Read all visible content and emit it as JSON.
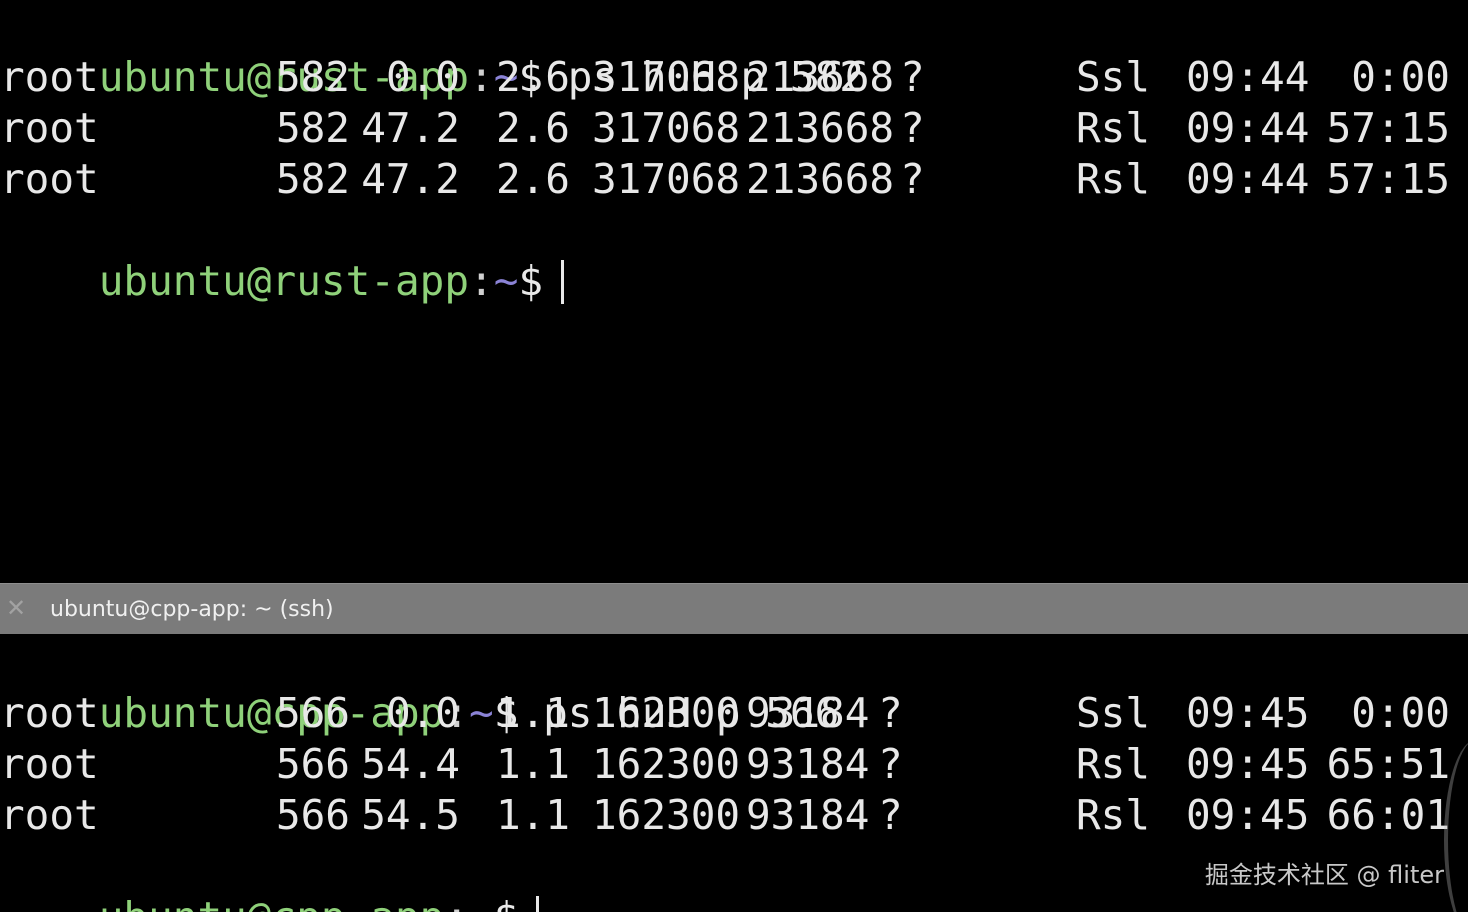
{
  "top_pane": {
    "prompt_user": "ubuntu@rust-app",
    "prompt_colon": ":",
    "prompt_tilde": "~",
    "prompt_dollar": "$",
    "command": "ps huH p 582",
    "rows": [
      {
        "user": "root",
        "pid": "582",
        "cpu": "0.0",
        "mem": "2.6",
        "vsz": "317068",
        "rss": "213668",
        "tty": "?",
        "stat": "Ssl",
        "start": "09:44",
        "time": "0:00"
      },
      {
        "user": "root",
        "pid": "582",
        "cpu": "47.2",
        "mem": "2.6",
        "vsz": "317068",
        "rss": "213668",
        "tty": "?",
        "stat": "Rsl",
        "start": "09:44",
        "time": "57:15"
      },
      {
        "user": "root",
        "pid": "582",
        "cpu": "47.2",
        "mem": "2.6",
        "vsz": "317068",
        "rss": "213668",
        "tty": "?",
        "stat": "Rsl",
        "start": "09:44",
        "time": "57:15"
      }
    ]
  },
  "tab": {
    "close_glyph": "✕",
    "title": "ubuntu@cpp-app: ~ (ssh)"
  },
  "bottom_pane": {
    "prompt_user": "ubuntu@cpp-app",
    "prompt_colon": ":",
    "prompt_tilde": "~",
    "prompt_dollar": "$",
    "command": "ps huH p 566",
    "rows": [
      {
        "user": "root",
        "pid": "566",
        "cpu": "0.0",
        "mem": "1.1",
        "vsz": "162300",
        "rss": "93184",
        "tty": "?",
        "stat": "Ssl",
        "start": "09:45",
        "time": "0:00"
      },
      {
        "user": "root",
        "pid": "566",
        "cpu": "54.4",
        "mem": "1.1",
        "vsz": "162300",
        "rss": "93184",
        "tty": "?",
        "stat": "Rsl",
        "start": "09:45",
        "time": "65:51"
      },
      {
        "user": "root",
        "pid": "566",
        "cpu": "54.5",
        "mem": "1.1",
        "vsz": "162300",
        "rss": "93184",
        "tty": "?",
        "stat": "Rsl",
        "start": "09:45",
        "time": "66:01"
      }
    ]
  },
  "watermark": "掘金技术社区 @ fliter",
  "colors": {
    "background": "#000000",
    "prompt_user": "#8fd17a",
    "prompt_tilde": "#8b83d6",
    "text": "#e8e8e8",
    "tabbar": "#7b7b7b"
  }
}
